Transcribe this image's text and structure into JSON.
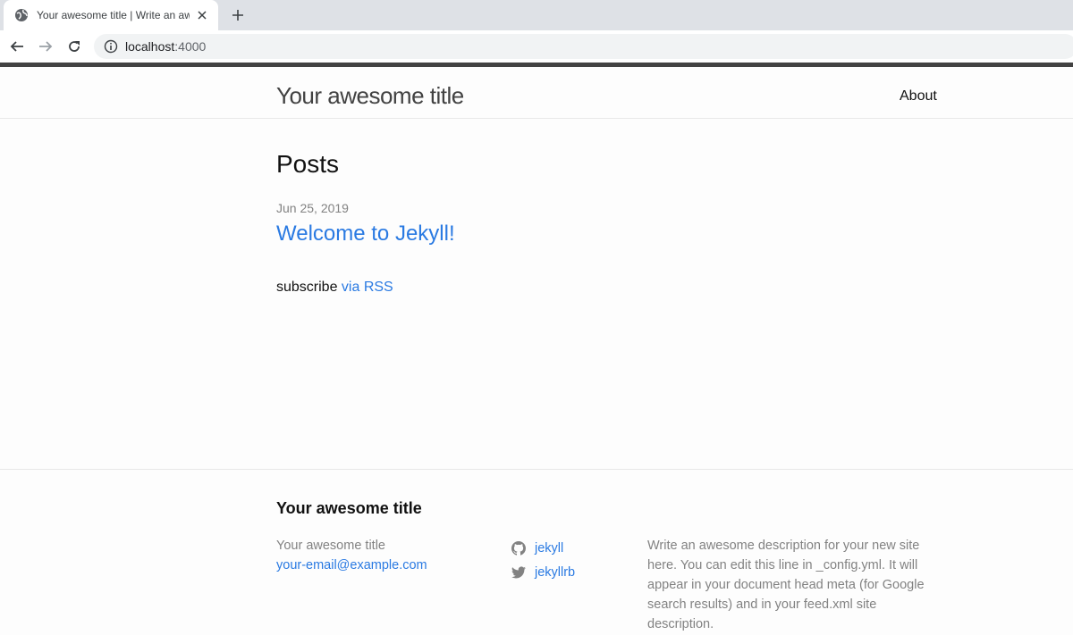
{
  "browser": {
    "tab_title": "Your awesome title | Write an awesome description for your new site",
    "url_host": "localhost",
    "url_port": ":4000"
  },
  "header": {
    "site_title": "Your awesome title",
    "nav_about": "About"
  },
  "main": {
    "heading": "Posts",
    "posts": [
      {
        "date": "Jun 25, 2019",
        "title": "Welcome to Jekyll!"
      }
    ],
    "rss_prefix": "subscribe ",
    "rss_via": "via ",
    "rss_link": "RSS"
  },
  "footer": {
    "heading": "Your awesome title",
    "col1_title": "Your awesome title",
    "email": "your-email@example.com",
    "social": [
      {
        "icon": "github-icon",
        "label": "jekyll"
      },
      {
        "icon": "twitter-icon",
        "label": "jekyllrb"
      }
    ],
    "description": "Write an awesome description for your new site here. You can edit this line in _config.yml. It will appear in your document head meta (for Google search results) and in your feed.xml site description."
  },
  "colors": {
    "accent": "#2a7ae2",
    "muted": "#828282",
    "header_border": "#424242"
  }
}
